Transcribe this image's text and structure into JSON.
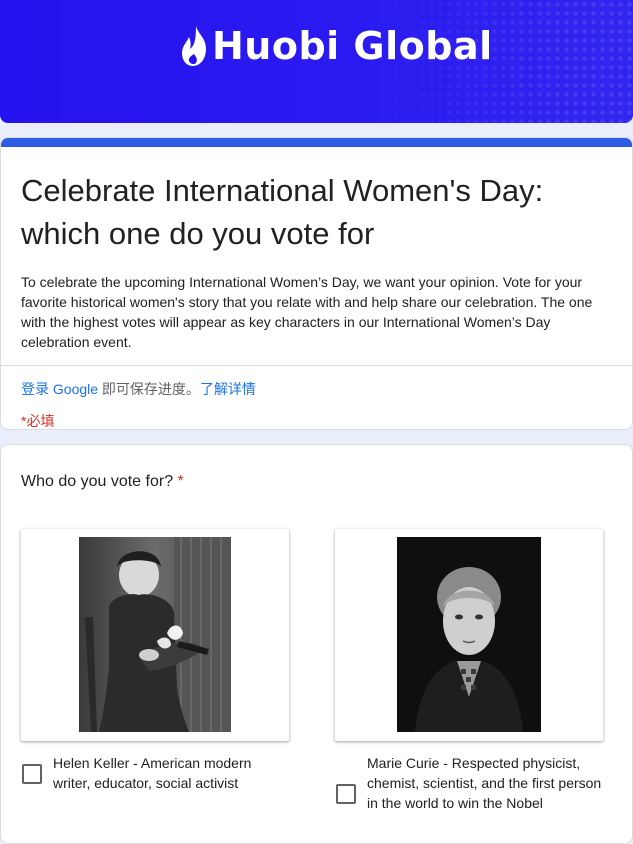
{
  "header": {
    "logo_text": "Huobi Global",
    "logo_icon": "flame-icon"
  },
  "form": {
    "title": "Celebrate International Women's Day: which one do you vote for",
    "description": "To celebrate the upcoming International Women’s Day, we want your opinion. Vote for your favorite historical women's story that you relate with and help share our celebration. The one with the highest votes will appear as key characters in our International Women’s Day celebration event.",
    "signin_link": "登录 Google",
    "signin_text": " 即可保存进度。",
    "learn_more": "了解详情",
    "required_note": "*必填"
  },
  "question": {
    "title": "Who do you vote for?",
    "required_mark": "*",
    "options": [
      {
        "label": "Helen Keller - American modern writer, educator, social activist",
        "checked": false
      },
      {
        "label": "Marie Curie - Respected physicist, chemist, scientist, and the first person in the world to win the Nobel",
        "checked": false
      }
    ]
  },
  "colors": {
    "banner": "#2612ee",
    "accent_bar": "#2d5be3",
    "link": "#1a73e8",
    "required": "#d93025"
  }
}
